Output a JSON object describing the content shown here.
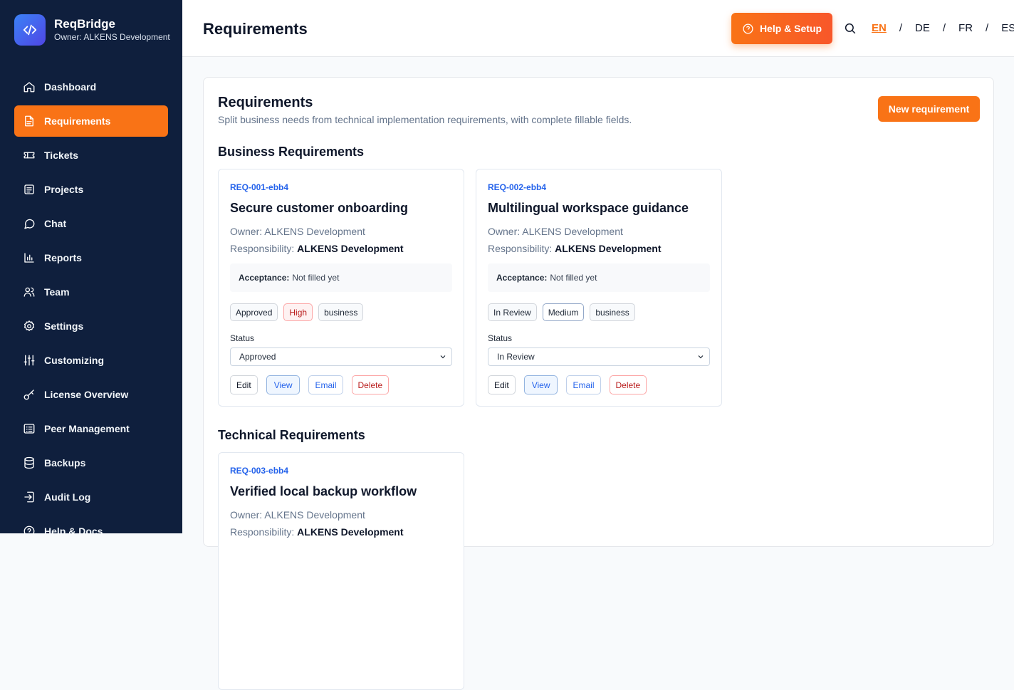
{
  "app": {
    "name": "ReqBridge",
    "owner": "Owner: ALKENS Development"
  },
  "sidebar": {
    "items": [
      {
        "label": "Dashboard",
        "icon": "home-icon"
      },
      {
        "label": "Requirements",
        "icon": "document-icon",
        "active": true
      },
      {
        "label": "Tickets",
        "icon": "ticket-icon"
      },
      {
        "label": "Projects",
        "icon": "list-icon"
      },
      {
        "label": "Chat",
        "icon": "chat-icon"
      },
      {
        "label": "Reports",
        "icon": "bar-chart-icon"
      },
      {
        "label": "Team",
        "icon": "users-icon"
      },
      {
        "label": "Settings",
        "icon": "gear-icon"
      },
      {
        "label": "Customizing",
        "icon": "sliders-icon"
      },
      {
        "label": "License Overview",
        "icon": "key-icon"
      },
      {
        "label": "Peer Management",
        "icon": "peer-list-icon"
      },
      {
        "label": "Backups",
        "icon": "database-icon"
      },
      {
        "label": "Audit Log",
        "icon": "sign-in-icon"
      },
      {
        "label": "Help & Docs",
        "icon": "help-circle-icon"
      }
    ]
  },
  "header": {
    "title": "Requirements",
    "help_label": "Help & Setup",
    "languages": [
      "EN",
      "DE",
      "FR",
      "ES"
    ],
    "active_language": "EN"
  },
  "colors": {
    "accent": "#f97316",
    "sidebar": "#0f1f3d",
    "link": "#2563eb"
  },
  "panel": {
    "title": "Requirements",
    "subtitle": "Split business needs from technical implementation requirements, with complete fillable fields.",
    "new_button": "New requirement",
    "business_title": "Business Requirements",
    "technical_title": "Technical Requirements"
  },
  "labels": {
    "owner_prefix": "Owner:",
    "responsibility_prefix": "Responsibility:",
    "acceptance_prefix": "Acceptance:",
    "status": "Status",
    "edit": "Edit",
    "view": "View",
    "email": "Email",
    "delete": "Delete"
  },
  "cards": [
    {
      "id": "REQ-001-ebb4",
      "title": "Secure customer onboarding",
      "owner": "Owner: ALKENS Development",
      "responsibility": "ALKENS Development",
      "acceptance": "Not filled yet",
      "tags": [
        "Approved",
        "High",
        "business"
      ],
      "status": "Approved"
    },
    {
      "id": "REQ-002-ebb4",
      "title": "Multilingual workspace guidance",
      "owner": "Owner: ALKENS Development",
      "responsibility": "ALKENS Development",
      "acceptance": "Not filled yet",
      "tags": [
        "In Review",
        "Medium",
        "business"
      ],
      "status": "In Review"
    },
    {
      "id": "REQ-003-ebb4",
      "title": "Verified local backup workflow",
      "owner": "Owner: ALKENS Development",
      "responsibility": "ALKENS Development",
      "acceptance": "",
      "tags": [],
      "status": ""
    }
  ]
}
